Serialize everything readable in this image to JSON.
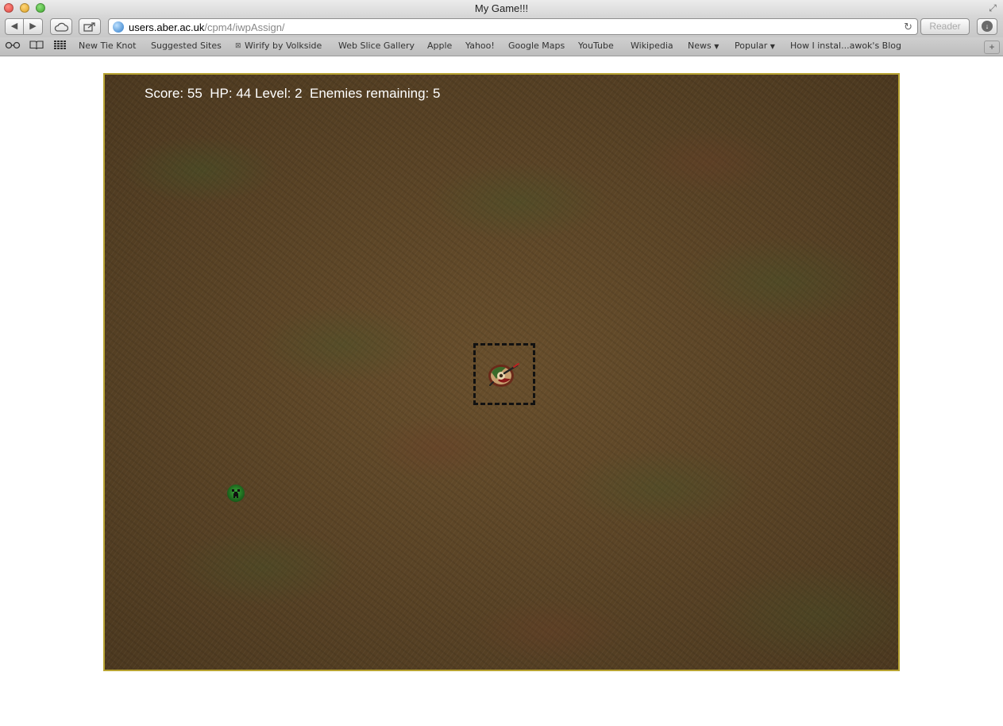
{
  "window": {
    "title": "My Game!!!"
  },
  "toolbar": {
    "back_label": "◀",
    "forward_label": "▶",
    "url_host": "users.aber.ac.uk",
    "url_path": "/cpm4/iwpAssign/",
    "reader_label": "Reader"
  },
  "bookmarks": {
    "items": [
      {
        "label": "New Tie Knot"
      },
      {
        "label": "Suggested Sites"
      },
      {
        "label": "Wirify by Volkside"
      },
      {
        "label": "Web Slice Gallery"
      },
      {
        "label": "Apple"
      },
      {
        "label": "Yahoo!"
      },
      {
        "label": "Google Maps"
      },
      {
        "label": "YouTube"
      },
      {
        "label": "Wikipedia"
      },
      {
        "label": "News"
      },
      {
        "label": "Popular"
      },
      {
        "label": "How I instal...awok's Blog"
      }
    ]
  },
  "game": {
    "hud": {
      "score_label": "Score:",
      "score": "55",
      "hp_label": "HP:",
      "hp": "44",
      "level_label": "Level:",
      "level": "2",
      "enemies_label": "Enemies remaining:",
      "enemies_remaining": "5"
    },
    "colors": {
      "ground": "#5e4728",
      "border": "#b8a332",
      "hud_text": "#ffffff",
      "enemy": "#2f8f2f"
    }
  }
}
